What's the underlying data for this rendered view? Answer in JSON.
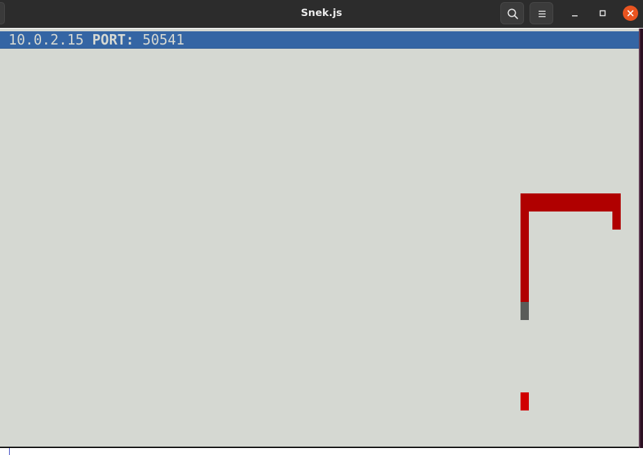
{
  "window": {
    "title": "Snek.js",
    "controls": {
      "search_icon": "search-icon",
      "menu_icon": "hamburger-menu-icon",
      "minimize_icon": "minimize-icon",
      "maximize_icon": "maximize-icon",
      "close_icon": "close-icon",
      "close_color": "#e95420"
    }
  },
  "status": {
    "host_suffix": ":",
    "host_value": "10.0.2.15",
    "port_label": "PORT:",
    "port_value": "50541",
    "background_color": "#3465a4"
  },
  "game": {
    "background_color": "#d5d8d2",
    "snake_color": "#b00000",
    "snake_tail_color": "#5a5c59",
    "food_color": "#d00000"
  }
}
